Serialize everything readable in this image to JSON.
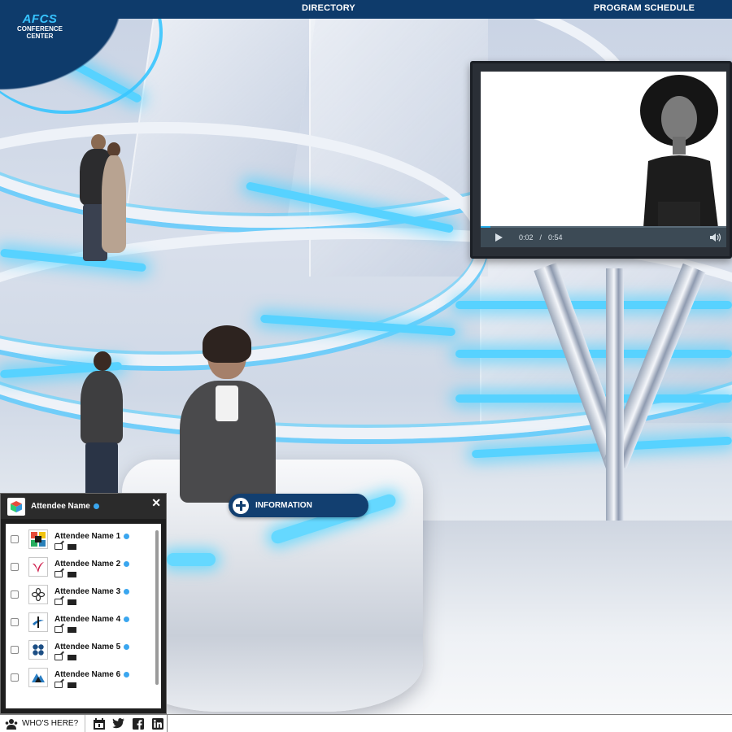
{
  "nav": {
    "logo_big": "AFCS",
    "logo_line1": "CONFERENCE",
    "logo_line2": "CENTER",
    "links": [
      "DIRECTORY",
      "PROGRAM SCHEDULE"
    ]
  },
  "video": {
    "current_time": "0:02",
    "separator": "/",
    "duration": "0:54",
    "progress_fraction": 0.04
  },
  "info_button": {
    "label": "INFORMATION"
  },
  "attendee_panel": {
    "title": "Attendee Name",
    "close_glyph": "✕",
    "attendees": [
      {
        "name": "Attendee Name 1",
        "logo": "colored-squares-logo"
      },
      {
        "name": "Attendee Name 2",
        "logo": "red-v-logo"
      },
      {
        "name": "Attendee Name 3",
        "logo": "flower-logo"
      },
      {
        "name": "Attendee Name 4",
        "logo": "blue-swoosh-logo"
      },
      {
        "name": "Attendee Name 5",
        "logo": "blue-knot-logo"
      },
      {
        "name": "Attendee Name 6",
        "logo": "mountain-logo"
      }
    ]
  },
  "bottom_bar": {
    "whos_here_label": "WHO'S HERE?",
    "social_icons": [
      "calendar-icon",
      "twitter-icon",
      "facebook-icon",
      "linkedin-icon"
    ]
  },
  "colors": {
    "nav_bg": "#0e3b6b",
    "accent_cyan": "#37c3ff",
    "online_dot": "#3aa6ef",
    "panel_header": "#2b2b2b"
  }
}
